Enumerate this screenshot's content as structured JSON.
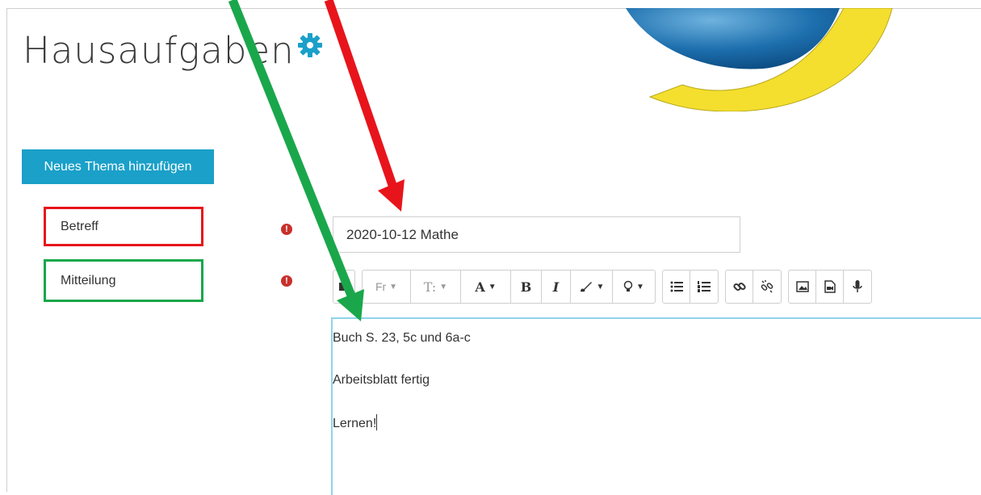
{
  "page": {
    "title": "Hausaufgaben"
  },
  "actions": {
    "new_topic_label": "Neues Thema hinzufügen"
  },
  "form": {
    "subject_label": "Betreff",
    "message_label": "Mitteilung",
    "required_icon": "!",
    "subject_value": "2020-10-12 Mathe"
  },
  "toolbar": {
    "font_family": "Fr",
    "font_size": "T:",
    "font_color": "A",
    "bold": "B",
    "italic": "I"
  },
  "editor": {
    "lines": [
      "Buch S. 23, 5c und 6a-c",
      "Arbeitsblatt fertig",
      "Lernen!"
    ]
  },
  "annotations": {
    "red": "#e8141b",
    "green": "#1aa74b"
  },
  "colors": {
    "accent": "#1aa0c9",
    "gear": "#1aa0c9",
    "required": "#c9302c"
  }
}
